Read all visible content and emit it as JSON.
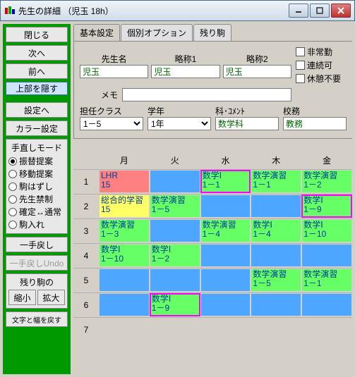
{
  "window": {
    "title": "先生の詳細 （児玉 18h）"
  },
  "sidebar": {
    "buttons": {
      "close": "閉じる",
      "next": "次へ",
      "prev": "前へ",
      "hide_top": "上部を隠す",
      "settings": "設定へ",
      "color": "カラー設定"
    },
    "mode": {
      "title": "手直しモード",
      "opts": [
        "振替提案",
        "移動提案",
        "駒はずし",
        "先生禁制",
        "確定↔通常",
        "駒入れ"
      ],
      "selected": 0
    },
    "undo": "一手戻し",
    "undo_redo": "一手戻しUndo",
    "remain": {
      "title": "残り駒の",
      "shrink": "縮小",
      "expand": "拡大"
    },
    "reset_width": "文字と幅を戻す"
  },
  "tabs": [
    "基本設定",
    "個別オプション",
    "残り駒"
  ],
  "form": {
    "labels": {
      "name": "先生名",
      "abbr1": "略称1",
      "abbr2": "略称2",
      "memo": "メモ",
      "class": "担任クラス",
      "year": "学年",
      "subject": "科･ｺﾒﾝﾄ",
      "duty": "校務"
    },
    "values": {
      "name": "児玉",
      "abbr1": "児玉",
      "abbr2": "児玉",
      "memo": "",
      "class": "1－5",
      "year": "1年",
      "subject": "数学科",
      "duty": "教務"
    },
    "checks": {
      "parttime": "非常勤",
      "consecutive": "連続可",
      "nobreak": "休憩不要"
    }
  },
  "grid": {
    "days": [
      "月",
      "火",
      "水",
      "木",
      "金"
    ],
    "rows": [
      [
        {
          "c": "pink",
          "t1": "LHR",
          "t2": "15"
        },
        {
          "c": "blue"
        },
        {
          "c": "green",
          "t1": "数学Ⅰ",
          "t2": "1－1",
          "hl": true
        },
        {
          "c": "green",
          "t1": "数学演習",
          "t2": "1－1"
        },
        {
          "c": "green",
          "t1": "数学演習",
          "t2": "1－2"
        }
      ],
      [
        {
          "c": "yellow",
          "t1": "総合的学習",
          "t2": "15"
        },
        {
          "c": "green",
          "t1": "数学演習",
          "t2": "1－5"
        },
        {
          "c": "blue"
        },
        {
          "c": "blue"
        },
        {
          "c": "green",
          "t1": "数学Ⅰ",
          "t2": "1－9",
          "hl": true
        }
      ],
      [
        {
          "c": "green",
          "t1": "数学演習",
          "t2": "1－3"
        },
        {
          "c": "blue"
        },
        {
          "c": "green",
          "t1": "数学演習",
          "t2": "1－4"
        },
        {
          "c": "green",
          "t1": "数学Ⅰ",
          "t2": "1－4"
        },
        {
          "c": "green",
          "t1": "数学Ⅰ",
          "t2": "1－10"
        }
      ],
      [
        {
          "c": "green",
          "t1": "数学Ⅰ",
          "t2": "1－10"
        },
        {
          "c": "green",
          "t1": "数学Ⅰ",
          "t2": "1－2"
        },
        {
          "c": "blue"
        },
        {
          "c": "blue"
        },
        {
          "c": "blue"
        }
      ],
      [
        {
          "c": "blue"
        },
        {
          "c": "blue"
        },
        {
          "c": "blue"
        },
        {
          "c": "green",
          "t1": "数学演習",
          "t2": "1－5"
        },
        {
          "c": "green",
          "t1": "数学演習",
          "t2": "1－1"
        }
      ],
      [
        {
          "c": "blue"
        },
        {
          "c": "green",
          "t1": "数学Ⅰ",
          "t2": "1－9",
          "hl": true
        },
        {
          "c": "blue"
        },
        {
          "c": "blue"
        },
        {
          "c": "blue"
        }
      ],
      [
        {
          "c": "empty"
        },
        {
          "c": "empty"
        },
        {
          "c": "empty"
        },
        {
          "c": "empty"
        },
        {
          "c": "empty"
        }
      ]
    ]
  }
}
